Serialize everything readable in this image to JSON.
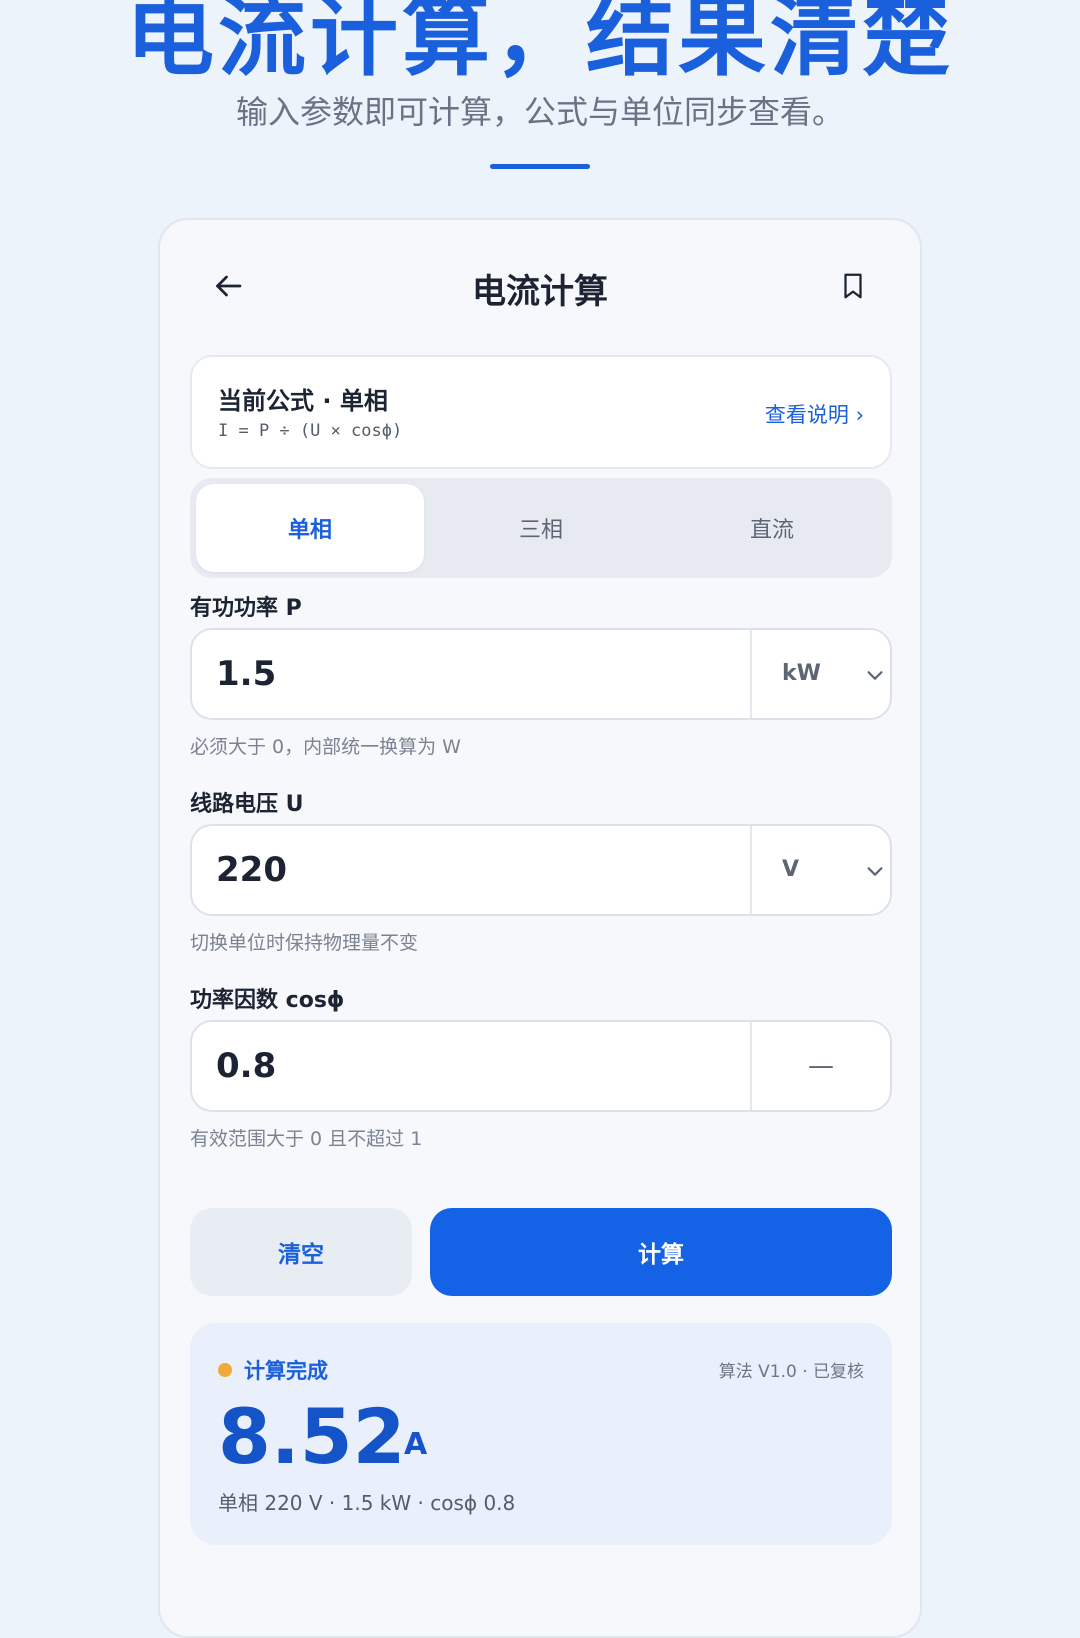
{
  "hero": {
    "title": "电流计算，结果清楚",
    "subtitle": "输入参数即可计算，公式与单位同步查看。"
  },
  "header": {
    "title": "电流计算",
    "back_icon": "arrow-left-icon",
    "bookmark_icon": "bookmark-icon"
  },
  "formula": {
    "title": "当前公式 · 单相",
    "expression": "I = P ÷ (U × cosϕ)",
    "link": "查看说明 ›"
  },
  "tabs": [
    {
      "label": "单相",
      "active": true
    },
    {
      "label": "三相",
      "active": false
    },
    {
      "label": "直流",
      "active": false
    }
  ],
  "fields": {
    "power": {
      "label": "有功功率 P",
      "value": "1.5",
      "unit": "kW",
      "hint": "必须大于 0，内部统一换算为 W"
    },
    "voltage": {
      "label": "线路电压 U",
      "value": "220",
      "unit": "V",
      "hint": "切换单位时保持物理量不变"
    },
    "pf": {
      "label": "功率因数 cosϕ",
      "value": "0.8",
      "unit": "—",
      "hint": "有效范围大于 0 且不超过 1"
    }
  },
  "actions": {
    "clear": "清空",
    "calculate": "计算"
  },
  "result": {
    "status": "计算完成",
    "meta": "算法 V1.0 · 已复核",
    "value": "8.52",
    "unit": "A",
    "detail": "单相 220 V · 1.5 kW · cosϕ 0.8"
  },
  "colors": {
    "accent": "#1463e6",
    "status_dot": "#f2a93b"
  }
}
